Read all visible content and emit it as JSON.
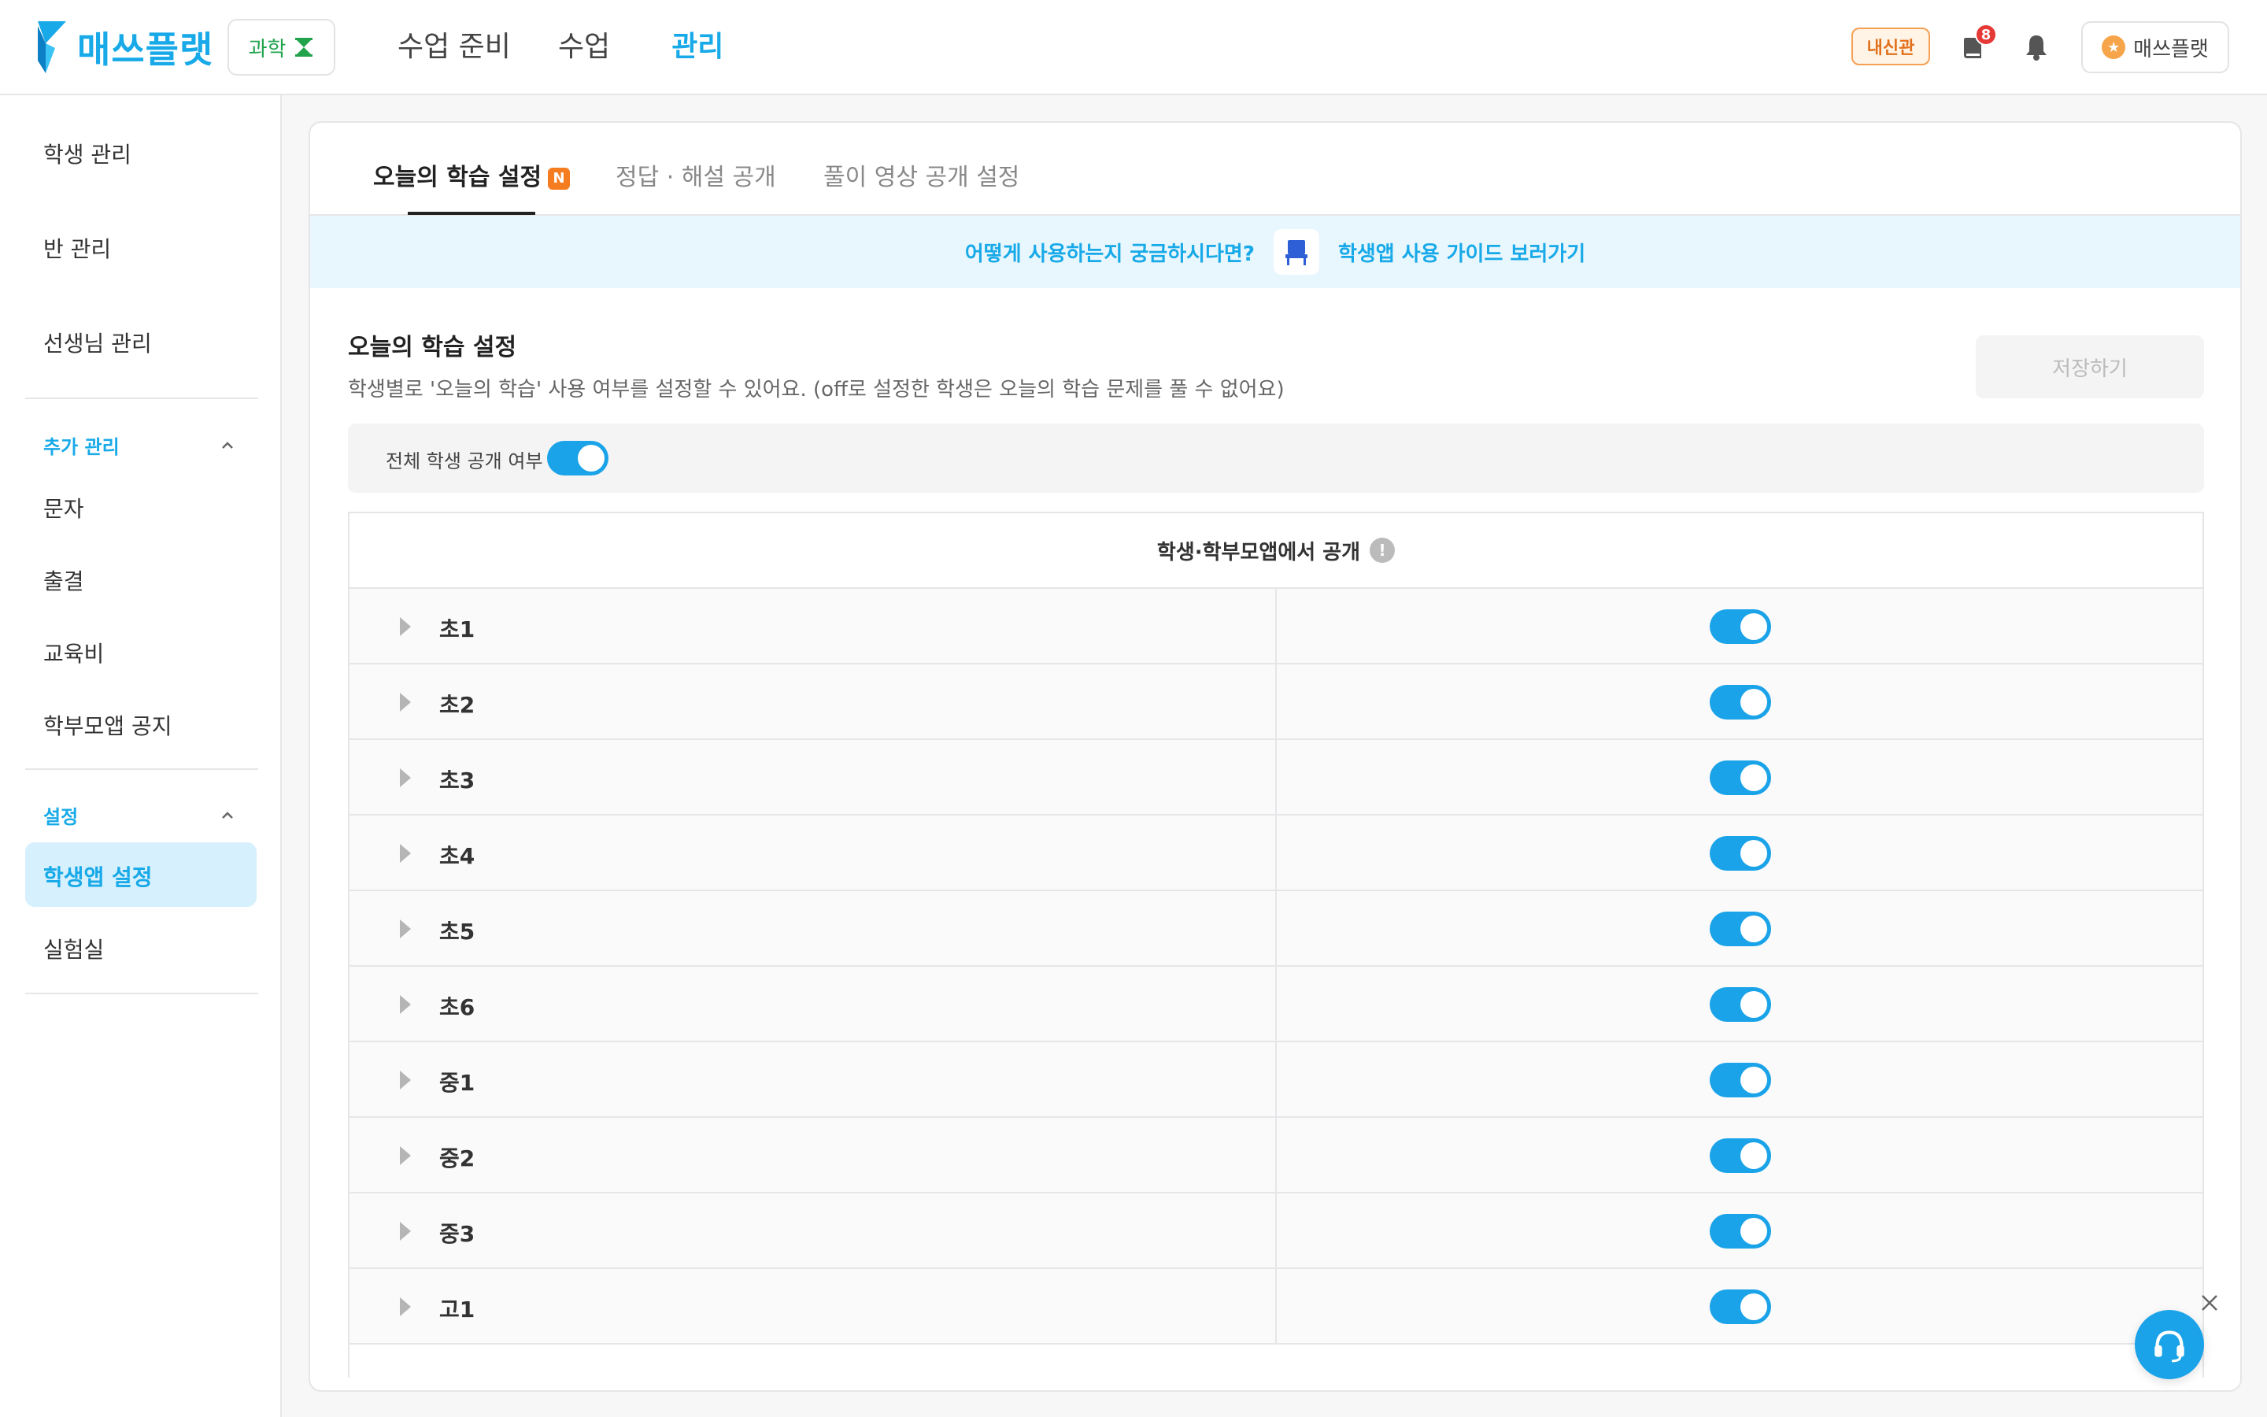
{
  "header": {
    "logo_text": "매쓰플랫",
    "subject_label": "과학",
    "nav": [
      "수업 준비",
      "수업",
      "관리"
    ],
    "nav_active": "관리",
    "naesin_badge": "내신관",
    "notification_count": "8",
    "user_name": "매쓰플랫"
  },
  "sidebar": {
    "top_items": [
      "학생 관리",
      "반 관리",
      "선생님 관리"
    ],
    "group1_title": "추가 관리",
    "group1_items": [
      "문자",
      "출결",
      "교육비",
      "학부모앱 공지"
    ],
    "group2_title": "설정",
    "group2_items": [
      "학생앱 설정",
      "실험실"
    ],
    "active_item": "학생앱 설정"
  },
  "tabs": {
    "items": [
      "오늘의 학습 설정",
      "정답 · 해설 공개",
      "풀이 영상 공개 설정"
    ],
    "new_badge": "N"
  },
  "guide": {
    "question": "어떻게 사용하는지 궁금하시다면?",
    "link": "학생앱 사용 가이드 보러가기"
  },
  "section": {
    "title": "오늘의 학습 설정",
    "description": "학생별로 '오늘의 학습' 사용 여부를 설정할 수 있어요. (off로 설정한 학생은 오늘의 학습 문제를 풀 수 없어요)",
    "save_label": "저장하기",
    "all_public_label": "전체 학생 공개 여부",
    "all_public_on": true
  },
  "table": {
    "header": "학생·학부모앱에서 공개",
    "info_icon": "!",
    "rows": [
      {
        "grade": "초1",
        "on": true
      },
      {
        "grade": "초2",
        "on": true
      },
      {
        "grade": "초3",
        "on": true
      },
      {
        "grade": "초4",
        "on": true
      },
      {
        "grade": "초5",
        "on": true
      },
      {
        "grade": "초6",
        "on": true
      },
      {
        "grade": "중1",
        "on": true
      },
      {
        "grade": "중2",
        "on": true
      },
      {
        "grade": "중3",
        "on": true
      },
      {
        "grade": "고1",
        "on": true
      }
    ]
  },
  "colors": {
    "brand": "#17a9e8",
    "toggle_on": "#1aa3e8",
    "naesin": "#e2701a",
    "new_badge": "#f57c1f"
  }
}
